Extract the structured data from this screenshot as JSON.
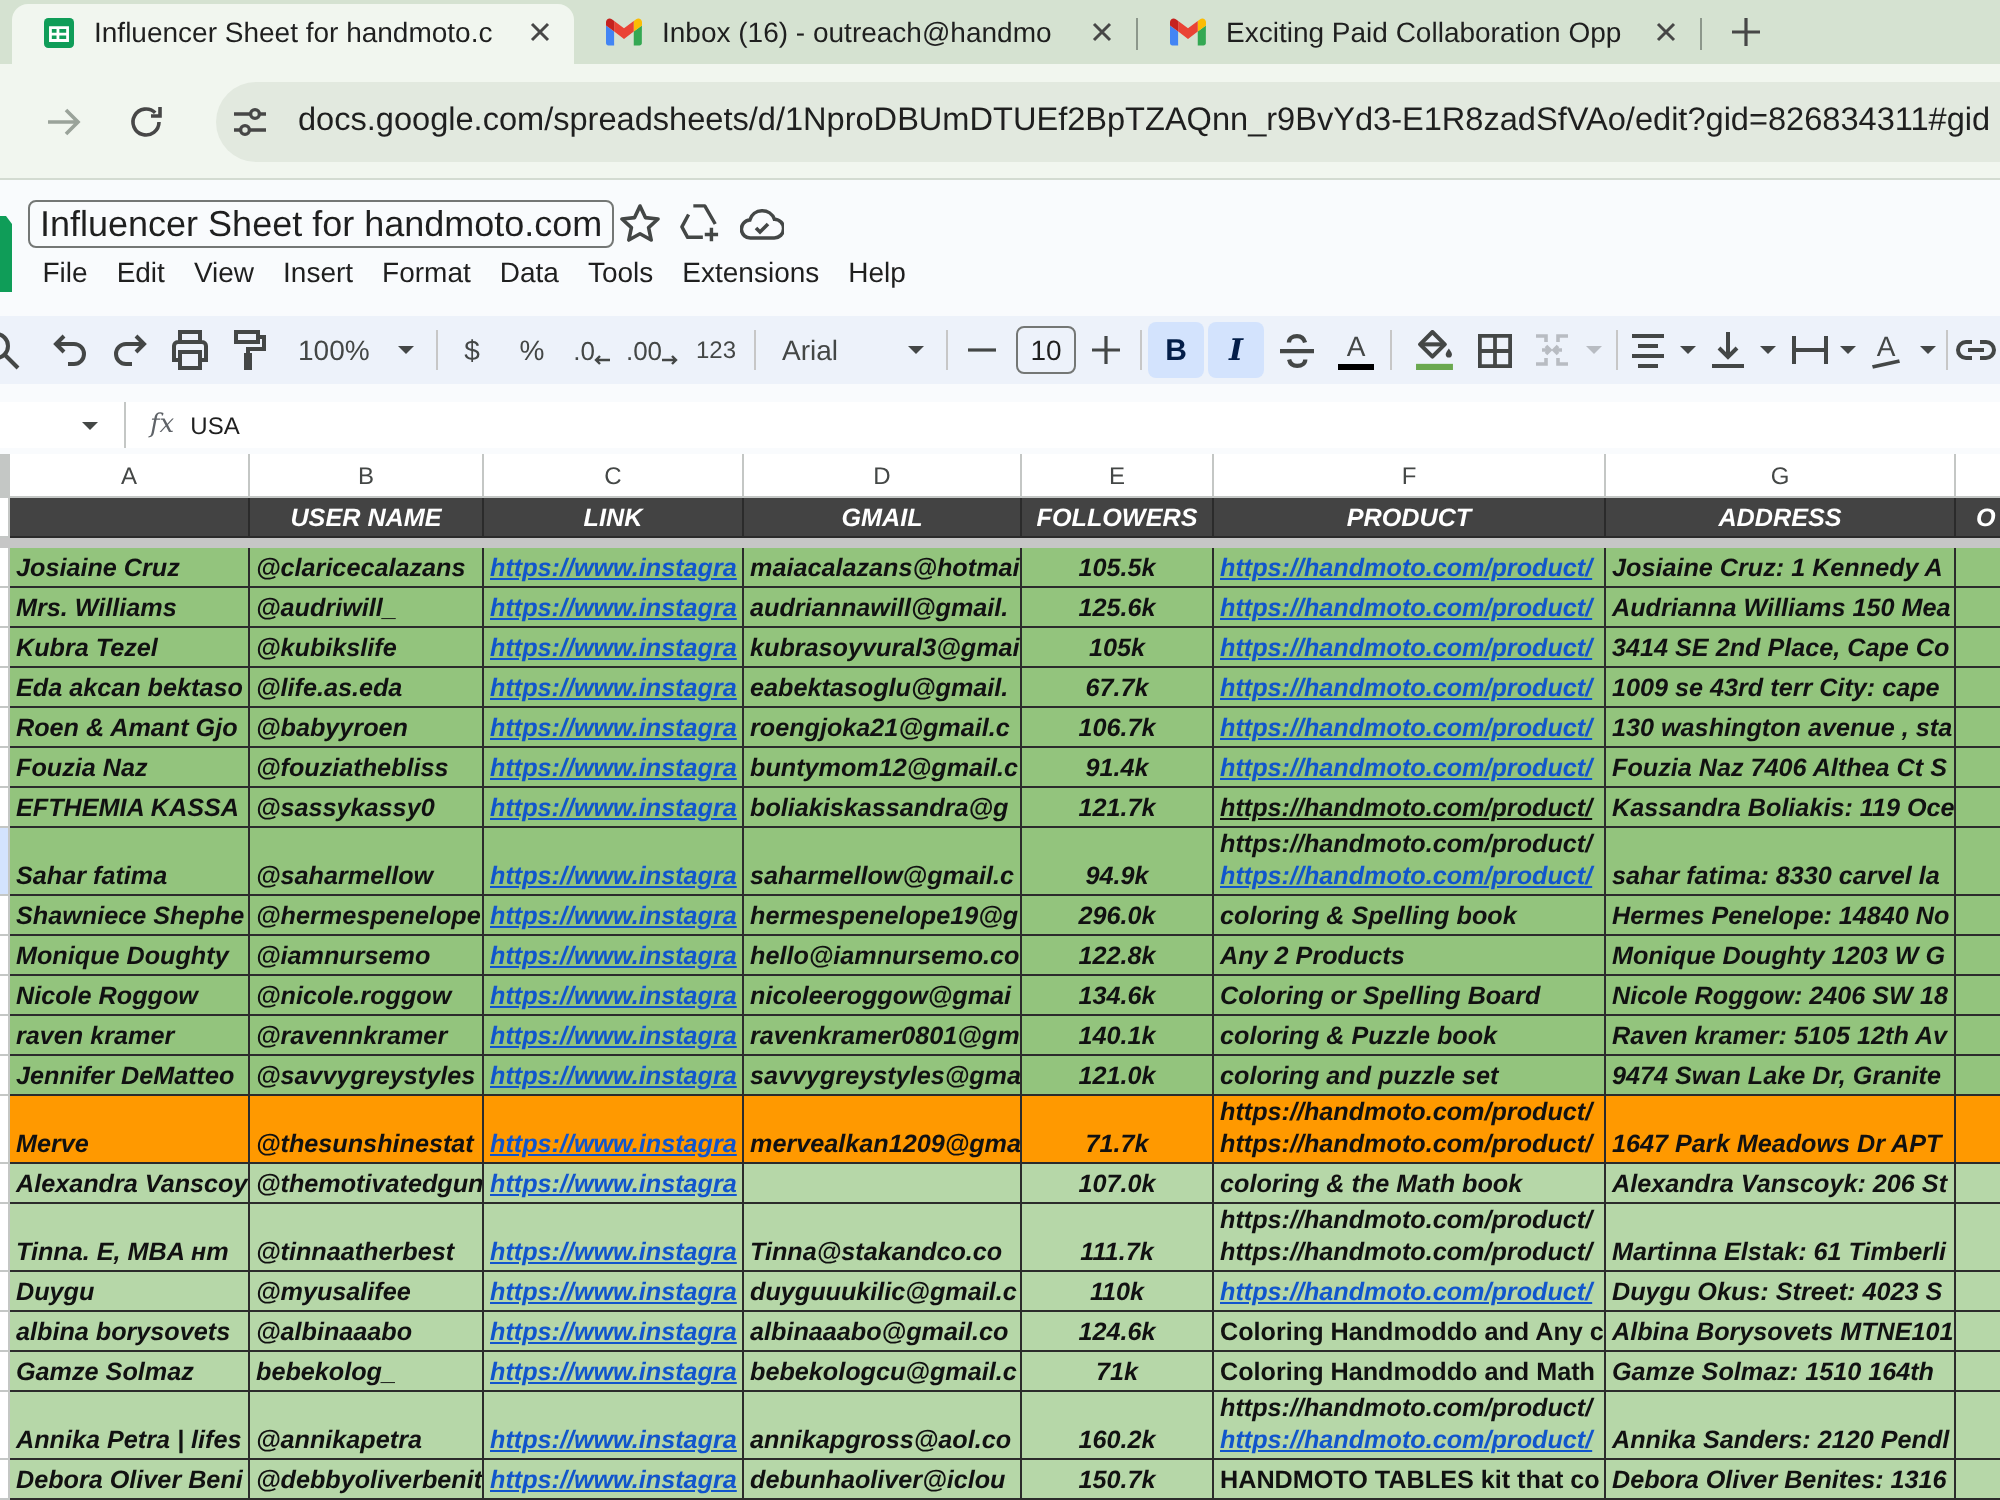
{
  "browser": {
    "tabs": [
      {
        "title": "Influencer Sheet for handmoto.c",
        "kind": "spreadsheet",
        "selected": true
      },
      {
        "title": "Inbox (16) - outreach@handmo",
        "kind": "mail",
        "selected": false
      },
      {
        "title": "Exciting Paid Collaboration Opp",
        "kind": "mail",
        "selected": false
      }
    ],
    "url": "docs.google.com/spreadsheets/d/1NproDBUmDTUEf2BpTZAQnn_r9BvYd3-E1R8zadSfVAo/edit?gid=826834311#gid"
  },
  "doc": {
    "title": "Influencer Sheet for handmoto.com",
    "menu": [
      "File",
      "Edit",
      "View",
      "Insert",
      "Format",
      "Data",
      "Tools",
      "Extensions",
      "Help"
    ]
  },
  "toolbar": {
    "zoom": "100%",
    "currency": "$",
    "percent": "%",
    "decimal_decrease": ".0",
    "decimal_increase": ".00",
    "number_format": "123",
    "font": "Arial",
    "font_size": "10",
    "bold": {
      "label": "B",
      "on": true
    },
    "italic": {
      "label": "I",
      "on": true
    },
    "text_color": "A",
    "text_rotation": "A"
  },
  "formula_bar": {
    "fx": "fx",
    "value": "USA"
  },
  "sheet": {
    "columns": [
      {
        "letter": "A"
      },
      {
        "letter": "B",
        "heading": "USER NAME"
      },
      {
        "letter": "C",
        "heading": "LINK"
      },
      {
        "letter": "D",
        "heading": "GMAIL"
      },
      {
        "letter": "E",
        "heading": "FOLLOWERS"
      },
      {
        "letter": "F",
        "heading": "PRODUCT"
      },
      {
        "letter": "G",
        "heading": "ADDRESS"
      },
      {
        "heading": "O"
      }
    ],
    "rows": [
      {
        "color": "#93c47d",
        "selected": false,
        "column_a": "Josiaine Cruz",
        "user_name": "@claricecalazans",
        "link": "https://www.instagra",
        "gmail": "maiacalazans@hotmai",
        "followers": "105.5k",
        "product": [
          {
            "text": "https://handmoto.com/product/",
            "kind": "link"
          }
        ],
        "address": "Josiaine Cruz: 1 Kennedy A"
      },
      {
        "color": "#93c47d",
        "selected": false,
        "column_a": "Mrs. Williams",
        "user_name": "@audriwill_",
        "link": "https://www.instagra",
        "gmail": "audriannawill@gmail.",
        "followers": "125.6k",
        "product": [
          {
            "text": "https://handmoto.com/product/",
            "kind": "link"
          }
        ],
        "address": "Audrianna Williams 150 Mea"
      },
      {
        "color": "#93c47d",
        "selected": false,
        "column_a": "Kubra Tezel",
        "user_name": "@kubikslife",
        "link": "https://www.instagra",
        "gmail": "kubrasoyvural3@gmai",
        "followers": "105k",
        "product": [
          {
            "text": "https://handmoto.com/product/",
            "kind": "link"
          }
        ],
        "address": "3414 SE 2nd Place, Cape Co"
      },
      {
        "color": "#93c47d",
        "selected": false,
        "column_a": "Eda akcan bektaso",
        "user_name": "@life.as.eda",
        "link": "https://www.instagra",
        "gmail": "eabektasoglu@gmail.",
        "followers": "67.7k",
        "product": [
          {
            "text": "https://handmoto.com/product/",
            "kind": "link"
          }
        ],
        "address": "1009 se 43rd terr City: cape"
      },
      {
        "color": "#93c47d",
        "selected": false,
        "column_a": "Roen & Amant Gjo",
        "user_name": "@babyyroen",
        "link": "https://www.instagra",
        "gmail": "roengjoka21@gmail.c",
        "followers": "106.7k",
        "product": [
          {
            "text": "https://handmoto.com/product/",
            "kind": "link"
          }
        ],
        "address": "130 washington avenue , sta"
      },
      {
        "color": "#93c47d",
        "selected": false,
        "column_a": "Fouzia Naz",
        "user_name": "@fouziathebliss",
        "link": "https://www.instagra",
        "gmail": "buntymom12@gmail.c",
        "followers": "91.4k",
        "product": [
          {
            "text": "https://handmoto.com/product/",
            "kind": "link"
          }
        ],
        "address": "Fouzia Naz 7406 Althea Ct S"
      },
      {
        "color": "#93c47d",
        "selected": false,
        "column_a": "EFTHEMIA KASSA",
        "user_name": "@sassykassy0",
        "link": "https://www.instagra",
        "gmail": "boliakiskassandra@g",
        "followers": "121.7k",
        "product": [
          {
            "text": "https://handmoto.com/product/",
            "kind": "underlined"
          }
        ],
        "address": "Kassandra Boliakis: 119 Oce"
      },
      {
        "color": "#93c47d",
        "selected": true,
        "column_a": "Sahar fatima",
        "user_name": "@saharmellow",
        "link": "https://www.instagra",
        "gmail": "saharmellow@gmail.c",
        "followers": "94.9k",
        "product": [
          {
            "text": "https://handmoto.com/product/",
            "kind": "text"
          },
          {
            "text": "https://handmoto.com/product/",
            "kind": "link"
          }
        ],
        "address": "sahar fatima: 8330 carvel la"
      },
      {
        "color": "#93c47d",
        "selected": false,
        "column_a": "Shawniece Shephe",
        "user_name": "@hermespenelope",
        "link": "https://www.instagra",
        "gmail": "hermespenelope19@g",
        "followers": "296.0k",
        "product": [
          {
            "text": "coloring & Spelling book",
            "kind": "text"
          }
        ],
        "address": "Hermes Penelope: 14840 No"
      },
      {
        "color": "#93c47d",
        "selected": false,
        "column_a": "Monique Doughty",
        "user_name": "@iamnursemo",
        "link": "https://www.instagra",
        "gmail": "hello@iamnursemo.co",
        "followers": "122.8k",
        "product": [
          {
            "text": "Any 2 Products",
            "kind": "text"
          }
        ],
        "address": "Monique Doughty 1203 W G"
      },
      {
        "color": "#93c47d",
        "selected": false,
        "column_a": "Nicole Roggow",
        "user_name": "@nicole.roggow",
        "link": "https://www.instagra",
        "gmail": "nicoleeroggow@gmai",
        "followers": "134.6k",
        "product": [
          {
            "text": "Coloring or Spelling Board",
            "kind": "text"
          }
        ],
        "address": "Nicole Roggow: 2406 SW 18"
      },
      {
        "color": "#93c47d",
        "selected": false,
        "column_a": "raven kramer",
        "user_name": "@ravennkramer",
        "link": "https://www.instagra",
        "gmail": "ravenkramer0801@gm",
        "followers": "140.1k",
        "product": [
          {
            "text": "coloring & Puzzle book",
            "kind": "text"
          }
        ],
        "address": "Raven kramer: 5105 12th Av"
      },
      {
        "color": "#93c47d",
        "selected": false,
        "column_a": "Jennifer DeMatteo",
        "user_name": "@savvygreystyles",
        "link": "https://www.instagra",
        "gmail": "savvygreystyles@gma",
        "followers": "121.0k",
        "product": [
          {
            "text": "coloring and puzzle set",
            "kind": "text"
          }
        ],
        "address": "9474 Swan Lake Dr, Granite"
      },
      {
        "color": "#ff9900",
        "selected": false,
        "column_a": "Merve",
        "user_name": "@thesunshinestat",
        "link": "https://www.instagra",
        "gmail": "mervealkan1209@gma",
        "followers": "71.7k",
        "product": [
          {
            "text": "https://handmoto.com/product/",
            "kind": "text"
          },
          {
            "text": "https://handmoto.com/product/",
            "kind": "text"
          }
        ],
        "address": "1647 Park Meadows Dr APT"
      },
      {
        "color": "#b6d7a8",
        "selected": false,
        "column_a": "Alexandra Vanscoy",
        "user_name": "@themotivatedgun",
        "link": "https://www.instagra",
        "followers": "107.0k",
        "product": [
          {
            "text": "coloring & the Math book",
            "kind": "text"
          }
        ],
        "address": "Alexandra Vanscoyk: 206 St"
      },
      {
        "color": "#b6d7a8",
        "selected": false,
        "column_a": "Tinna. E, MBA нт",
        "user_name": "@tinnaatherbest",
        "link": "https://www.instagra",
        "gmail": "Tinna@stakandco.co",
        "followers": "111.7k",
        "product": [
          {
            "text": "https://handmoto.com/product/",
            "kind": "text"
          },
          {
            "text": "https://handmoto.com/product/",
            "kind": "text"
          }
        ],
        "address": "Martinna Elstak: 61 Timberli"
      },
      {
        "color": "#b6d7a8",
        "selected": false,
        "column_a": "Duygu",
        "user_name": "@myusalifee",
        "link": "https://www.instagra",
        "gmail": "duyguuukilic@gmail.c",
        "followers": "110k",
        "product": [
          {
            "text": "https://handmoto.com/product/",
            "kind": "link"
          }
        ],
        "address": "Duygu Okus: Street: 4023 S"
      },
      {
        "color": "#b6d7a8",
        "selected": false,
        "column_a": "albina borysovets",
        "user_name": "@albinaaabo",
        "link": "https://www.instagra",
        "gmail": "albinaaabo@gmail.co",
        "followers": "124.6k",
        "product": [
          {
            "text": "Coloring Handmoddo and Any c",
            "kind": "upright"
          }
        ],
        "address": "Albina Borysovets MTNE101"
      },
      {
        "color": "#b6d7a8",
        "selected": false,
        "column_a": "Gamze Solmaz",
        "user_name": "bebekolog_",
        "link": "https://www.instagra",
        "gmail": "bebekologcu@gmail.c",
        "followers": "71k",
        "product": [
          {
            "text": "Coloring Handmoddo and Math",
            "kind": "upright"
          }
        ],
        "address": "Gamze Solmaz: 1510 164th"
      },
      {
        "color": "#b6d7a8",
        "selected": false,
        "column_a": "Annika Petra | lifes",
        "user_name": "@annikapetra",
        "link": "https://www.instagra",
        "gmail": "annikapgross@aol.co",
        "followers": "160.2k",
        "product": [
          {
            "text": "https://handmoto.com/product/",
            "kind": "text"
          },
          {
            "text": "https://handmoto.com/product/",
            "kind": "link"
          }
        ],
        "address": "Annika Sanders: 2120 Pendl"
      },
      {
        "color": "#b6d7a8",
        "selected": false,
        "column_a": "Debora Oliver Beni",
        "user_name": "@debbyoliverbenit",
        "link": "https://www.instagra",
        "gmail": "debunhaoliver@iclou",
        "followers": "150.7k",
        "product": [
          {
            "text": "HANDMOTO TABLES kit that co",
            "kind": "upright"
          }
        ],
        "address": "Debora Oliver Benites: 1316"
      }
    ]
  }
}
